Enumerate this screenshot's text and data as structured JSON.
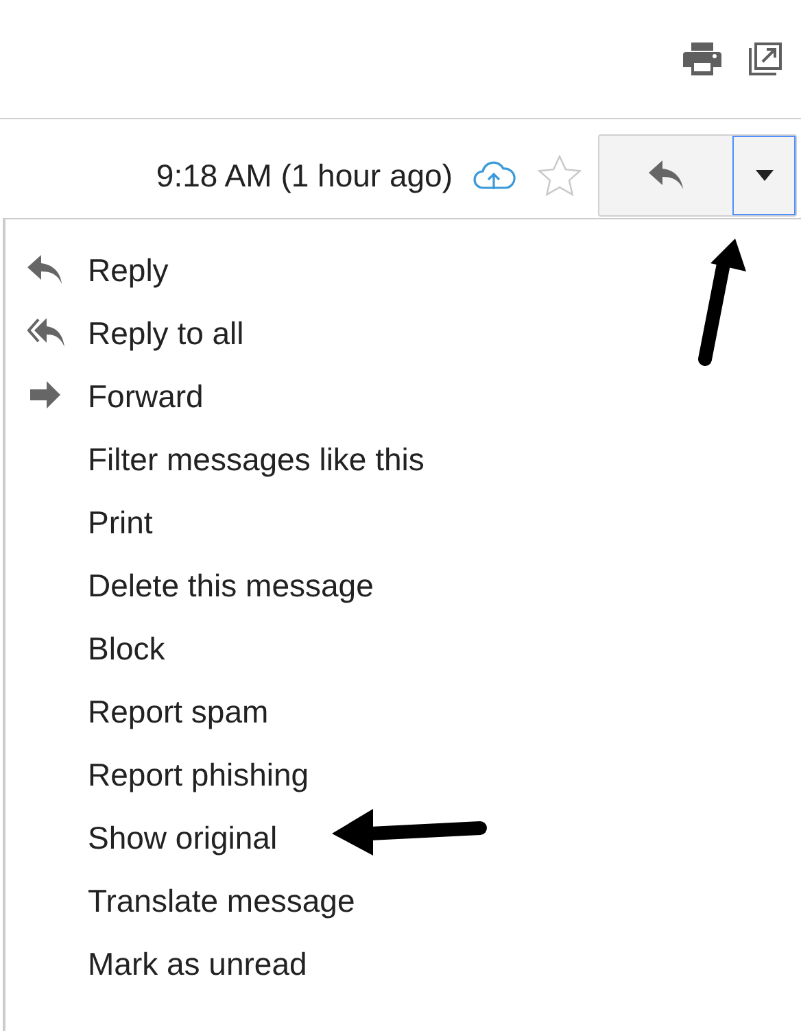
{
  "header": {
    "time": "9:18 AM (1 hour ago)",
    "starred": false
  },
  "menu": [
    {
      "label": "Reply",
      "kind": "reply"
    },
    {
      "label": "Reply to all",
      "kind": "reply_all"
    },
    {
      "label": "Forward",
      "kind": "forward"
    },
    {
      "label": "Filter messages like this",
      "kind": "plain"
    },
    {
      "label": "Print",
      "kind": "plain"
    },
    {
      "label": "Delete this message",
      "kind": "plain"
    },
    {
      "label": "Block",
      "kind": "plain"
    },
    {
      "label": "Report spam",
      "kind": "plain"
    },
    {
      "label": "Report phishing",
      "kind": "plain"
    },
    {
      "label": "Show original",
      "kind": "plain"
    },
    {
      "label": "Translate message",
      "kind": "plain"
    },
    {
      "label": "Mark as unread",
      "kind": "plain"
    }
  ]
}
